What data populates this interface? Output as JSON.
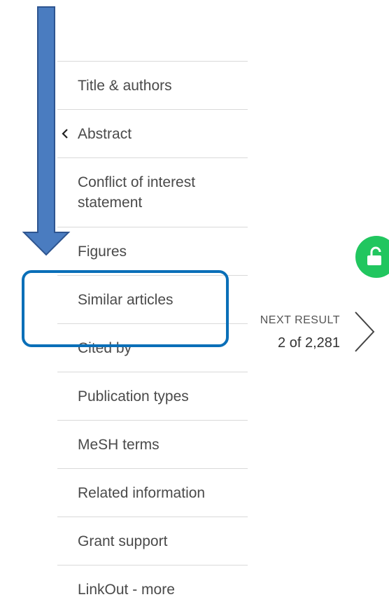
{
  "nav": {
    "items": [
      {
        "label": "Title & authors"
      },
      {
        "label": "Abstract"
      },
      {
        "label": "Conflict of interest statement"
      },
      {
        "label": "Figures"
      },
      {
        "label": "Similar articles"
      },
      {
        "label": "Cited by"
      },
      {
        "label": "Publication types"
      },
      {
        "label": "MeSH terms"
      },
      {
        "label": "Related information"
      },
      {
        "label": "Grant support"
      },
      {
        "label": "LinkOut - more"
      }
    ]
  },
  "next_result": {
    "label": "NEXT RESULT",
    "count": "2 of 2,281"
  },
  "colors": {
    "annotation_arrow": "#4a7cc0",
    "highlight_box": "#0a6fb8",
    "lock_button": "#21c65f"
  },
  "icons": [
    "chevron-left-icon",
    "chevron-right-icon",
    "unlock-icon"
  ]
}
